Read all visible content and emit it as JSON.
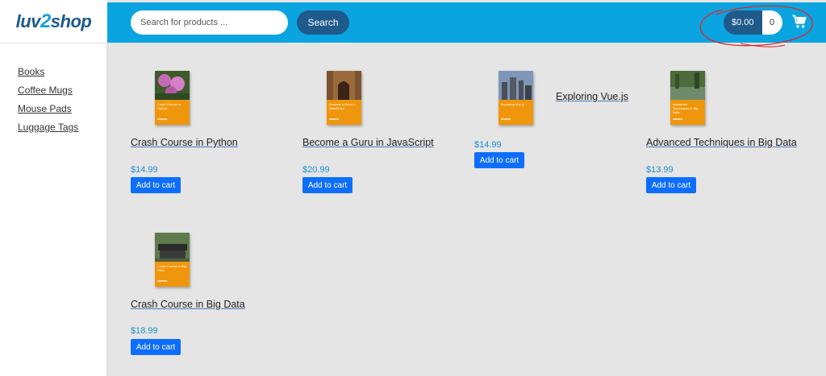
{
  "logo": {
    "text_left": "luv",
    "text_mid": "2",
    "text_right": "shop"
  },
  "search": {
    "placeholder": "Search for products ...",
    "button_label": "Search"
  },
  "cart": {
    "total": "$0.00",
    "quantity": "0"
  },
  "sidebar": {
    "items": [
      {
        "label": "Books"
      },
      {
        "label": "Coffee Mugs"
      },
      {
        "label": "Mouse Pads"
      },
      {
        "label": "Luggage Tags"
      }
    ]
  },
  "products": [
    {
      "title": "Crash Course in Python",
      "price": "$14.99",
      "button": "Add to cart",
      "cover_text": "Crash Course in Python"
    },
    {
      "title": "Become a Guru in JavaScript",
      "price": "$20.99",
      "button": "Add to cart",
      "cover_text": "Become a Guru in JavaScript"
    },
    {
      "title": "Exploring Vue.js",
      "price": "$14.99",
      "button": "Add to cart",
      "cover_text": "Exploring Vue.js"
    },
    {
      "title": "Advanced Techniques in Big Data",
      "price": "$13.99",
      "button": "Add to cart",
      "cover_text": "Advanced Techniques in Big Data"
    },
    {
      "title": "Crash Course in Big Data",
      "price": "$18.99",
      "button": "Add to cart",
      "cover_text": "Crash Course in Big Data"
    }
  ],
  "colors": {
    "header": "#0aa5e0",
    "dark_button": "#1e5a8a",
    "add_button": "#0d6efd",
    "price": "#1a8fd1",
    "cover": "#f0960c",
    "annotation": "#d9282f"
  }
}
